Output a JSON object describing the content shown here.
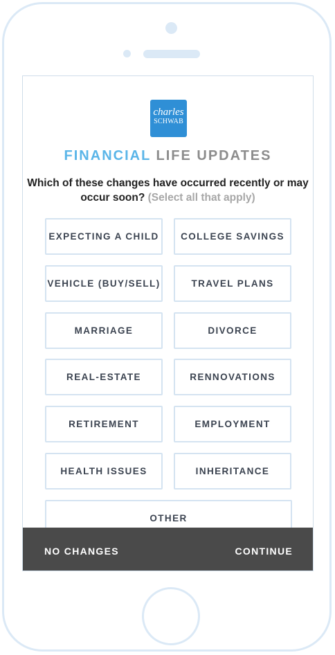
{
  "logo": {
    "line1": "charles",
    "line2": "SCHWAB"
  },
  "title": {
    "part1": "FINANCIAL",
    "part2": "LIFE UPDATES"
  },
  "question": {
    "text": "Which of these changes have occurred recently or may occur soon?",
    "hint": "(Select all that apply)"
  },
  "options": [
    "EXPECTING A CHILD",
    "COLLEGE SAVINGS",
    "VEHICLE (BUY/SELL)",
    "TRAVEL PLANS",
    "MARRIAGE",
    "DIVORCE",
    "REAL-ESTATE",
    "RENNOVATIONS",
    "RETIREMENT",
    "EMPLOYMENT",
    "HEALTH ISSUES",
    "INHERITANCE",
    "OTHER"
  ],
  "actions": {
    "no_changes": "NO CHANGES",
    "continue": "CONTINUE"
  },
  "colors": {
    "accent": "#5ab5e8",
    "brand": "#2f8fd6",
    "bar": "#4a4a4a",
    "frame": "#dbe9f6"
  }
}
